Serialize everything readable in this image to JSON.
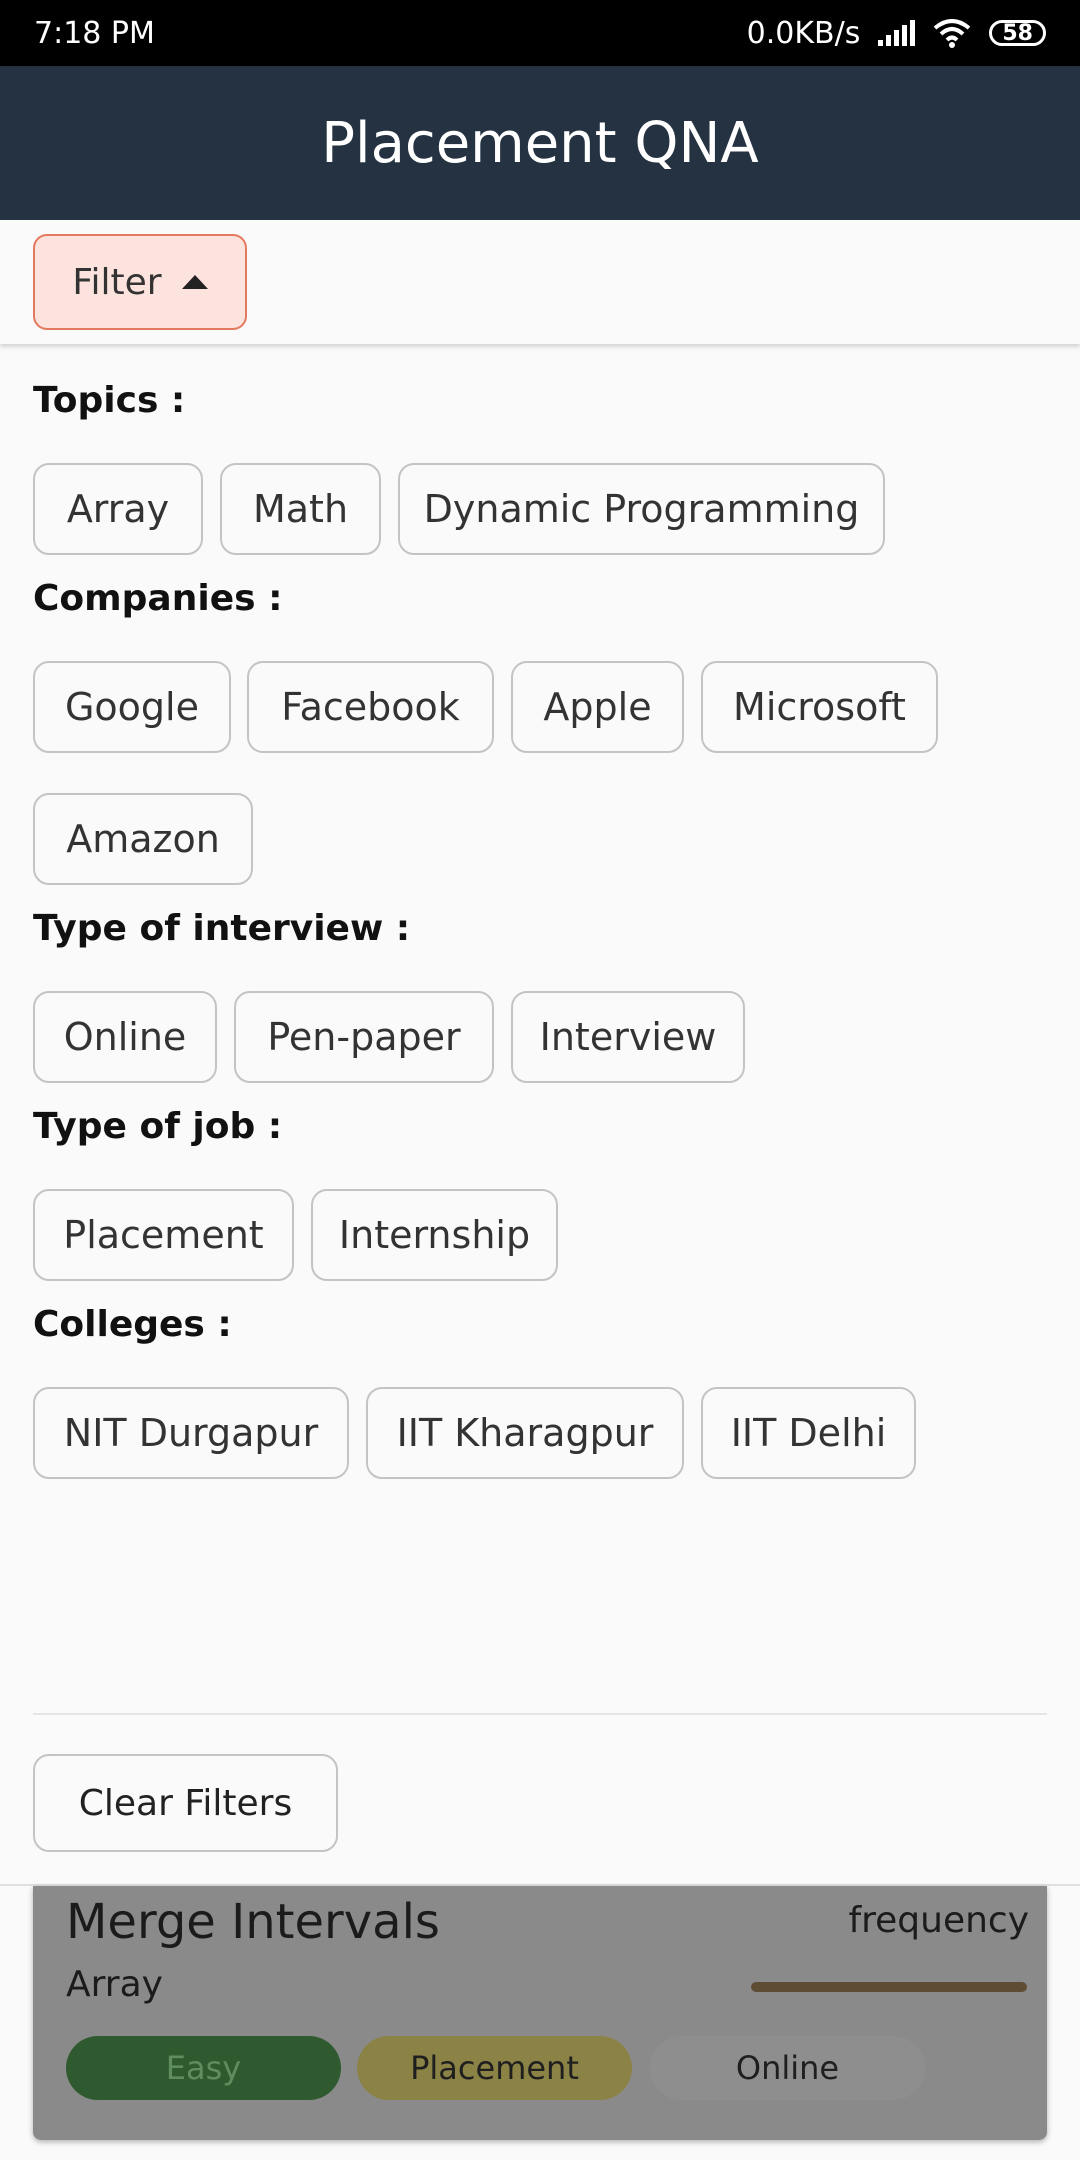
{
  "status_bar": {
    "time": "7:18 PM",
    "network_speed": "0.0KB/s",
    "battery": "58",
    "icons": [
      "signal-icon",
      "wifi-icon",
      "battery-icon"
    ]
  },
  "app_bar": {
    "title": "Placement QNA"
  },
  "filter": {
    "label": "Filter",
    "icon": "caret-up-icon"
  },
  "sections": {
    "topics": {
      "title": "Topics :",
      "chips": [
        "Array",
        "Math",
        "Dynamic Programming"
      ]
    },
    "companies": {
      "title": "Companies :",
      "chips": [
        "Google",
        "Facebook",
        "Apple",
        "Microsoft",
        "Amazon"
      ]
    },
    "interview": {
      "title": "Type of interview :",
      "chips": [
        "Online",
        "Pen-paper",
        "Interview"
      ]
    },
    "job": {
      "title": "Type of job :",
      "chips": [
        "Placement",
        "Internship"
      ]
    },
    "colleges": {
      "title": "Colleges :",
      "chips": [
        "NIT Durgapur",
        "IIT Kharagpur",
        "IIT Delhi"
      ]
    }
  },
  "clear_button": "Clear Filters",
  "question_card": {
    "title": "Merge Intervals",
    "frequency_label": "frequency",
    "topic": "Array",
    "tags": [
      "Easy",
      "Placement",
      "Online"
    ]
  },
  "colors": {
    "app_bar": "#243241",
    "filter_accent": "#e27a5f",
    "filter_bg": "#fde3dd",
    "easy_tag": "#2f5a2f",
    "placement_tag": "#8b8345"
  }
}
